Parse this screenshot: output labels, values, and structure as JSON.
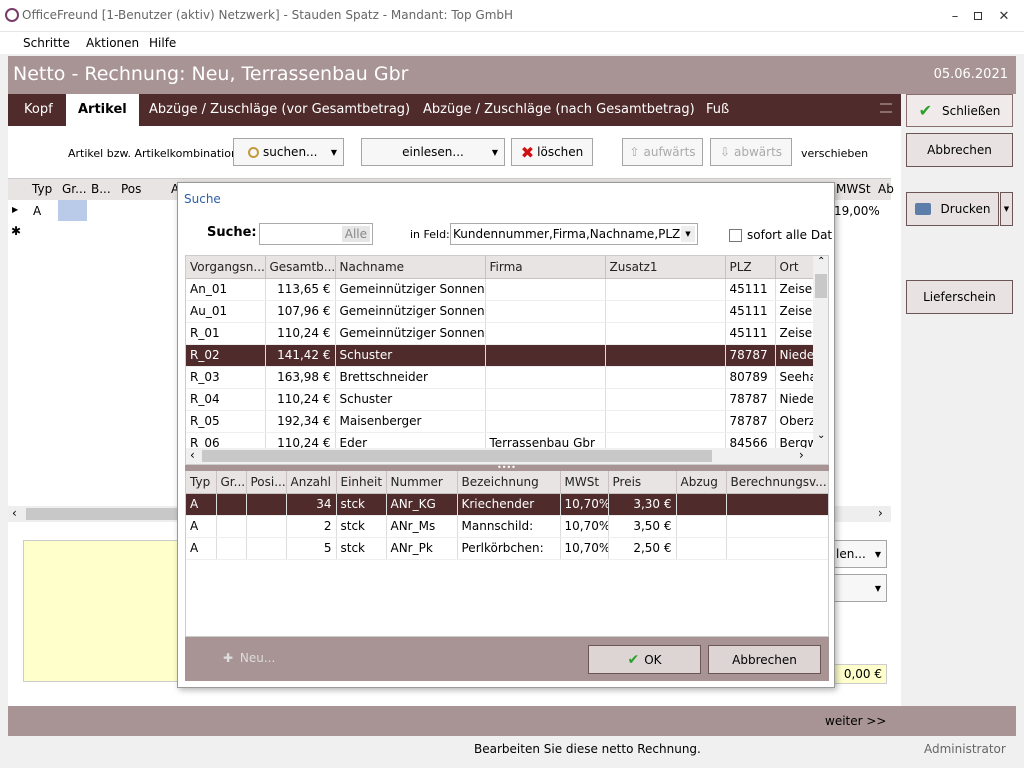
{
  "app": {
    "title": "OfficeFreund [1-Benutzer (aktiv) Netzwerk]  -  Stauden Spatz  -  Mandant: Top GmbH"
  },
  "menu": [
    "Schritte",
    "Aktionen",
    "Hilfe"
  ],
  "header": {
    "title": "Netto - Rechnung: Neu, Terrassenbau Gbr",
    "date": "05.06.2021"
  },
  "tabs": [
    "Kopf",
    "Artikel",
    "Abzüge / Zuschläge (vor Gesamtbetrag)",
    "Abzüge / Zuschläge (nach Gesamtbetrag)",
    "Fuß"
  ],
  "toolbar": {
    "label": "Artikel bzw. Artikelkombinationen",
    "search": "suchen...",
    "read": "einlesen...",
    "delete": "löschen",
    "up": "aufwärts",
    "down": "abwärts",
    "move": "verschieben"
  },
  "article_grid": {
    "headers": [
      "Typ",
      "Gr...",
      "B...",
      "Pos",
      "A"
    ],
    "row_type": "A",
    "mwst_header": "MWSt",
    "ab_header": "Ab",
    "mwst_value": "19,00%"
  },
  "right": {
    "close": "Schließen",
    "cancel": "Abbrechen",
    "print": "Drucken",
    "delivery": "Lieferschein"
  },
  "bottom": {
    "sel1": "len...",
    "total": "0,00 €",
    "next": "weiter >>"
  },
  "dialog": {
    "title": "Suche",
    "search_label": "Suche:",
    "search_value": "",
    "all": "Alle",
    "field_label": "in Feld:",
    "field_value": "Kundennummer,Firma,Nachname,PLZ",
    "checkbox_label": "sofort alle Daten",
    "upper_headers": [
      "Vorgangsn...",
      "Gesamtb...",
      "Nachname",
      "Firma",
      "Zusatz1",
      "PLZ",
      "Ort"
    ],
    "upper_rows": [
      [
        "An_01",
        "113,65 €",
        "Gemeinnütziger Sonnen...",
        "",
        "",
        "45111",
        "Zeisen"
      ],
      [
        "Au_01",
        "107,96 €",
        "Gemeinnütziger Sonnen...",
        "",
        "",
        "45111",
        "Zeisen"
      ],
      [
        "R_01",
        "110,24 €",
        "Gemeinnütziger Sonnen...",
        "",
        "",
        "45111",
        "Zeisen"
      ],
      [
        "R_02",
        "141,42 €",
        "Schuster",
        "",
        "",
        "78787",
        "Nieders"
      ],
      [
        "R_03",
        "163,98 €",
        "Brettschneider",
        "",
        "",
        "80789",
        "Seeha"
      ],
      [
        "R_04",
        "110,24 €",
        "Schuster",
        "",
        "",
        "78787",
        "Nieders"
      ],
      [
        "R_05",
        "192,34 €",
        "Maisenberger",
        "",
        "",
        "78787",
        "Oberz"
      ],
      [
        "R_06",
        "110,24 €",
        "Eder",
        "Terrassenbau Gbr",
        "",
        "84566",
        "Bergw"
      ]
    ],
    "lower_headers": [
      "Typ",
      "Gr...",
      "Posi...",
      "Anzahl",
      "Einheit",
      "Nummer",
      "Bezeichnung",
      "MWSt",
      "Preis",
      "Abzug",
      "Berechnungsv..."
    ],
    "lower_rows": [
      [
        "A",
        "",
        "",
        "34",
        "stck",
        "ANr_KG",
        "Kriechender",
        "10,70%",
        "3,30 €",
        "",
        ""
      ],
      [
        "A",
        "",
        "",
        "2",
        "stck",
        "ANr_Ms",
        "Mannschild:",
        "10,70%",
        "3,50 €",
        "",
        ""
      ],
      [
        "A",
        "",
        "",
        "5",
        "stck",
        "ANr_Pk",
        "Perlkörbchen:",
        "10,70%",
        "2,50 €",
        "",
        ""
      ]
    ],
    "new": "Neu...",
    "ok": "OK",
    "cancel": "Abbrechen"
  },
  "status": {
    "message": "Bearbeiten Sie diese netto Rechnung.",
    "user": "Administrator"
  },
  "colors": {
    "accent": "#4f2b2b",
    "header": "#a89494"
  }
}
